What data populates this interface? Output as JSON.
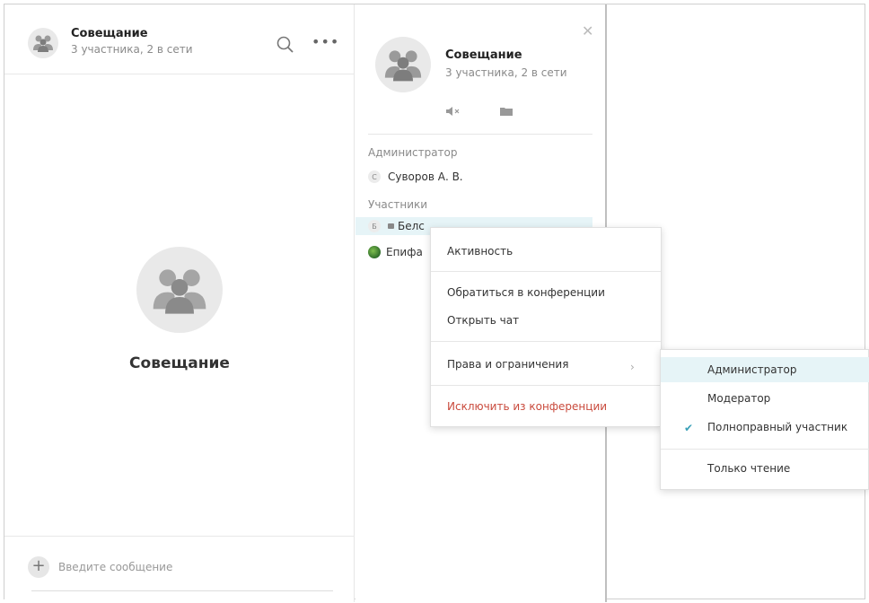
{
  "chat": {
    "title": "Совещание",
    "subtitle": "3 участника, 2 в сети",
    "center_title": "Совещание",
    "composer_placeholder": "Введите сообщение",
    "plus_label": "+"
  },
  "info_panel": {
    "title": "Совещание",
    "subtitle": "3 участника, 2 в сети",
    "admin_section": "Администратор",
    "members_section": "Участники",
    "admins": [
      {
        "initial": "С",
        "name": "Суворов А. В."
      }
    ],
    "members": [
      {
        "initial": "Б",
        "name": "Белс"
      },
      {
        "initial": "",
        "name": "Епифа"
      }
    ]
  },
  "context_menu": {
    "items": [
      "Активность",
      "Обратиться в конференции",
      "Открыть чат",
      "Права и ограничения",
      "Исключить из конференции"
    ]
  },
  "rights_submenu": {
    "items": [
      "Администратор",
      "Модератор",
      "Полноправный участник",
      "Только чтение"
    ],
    "selected": "Полноправный участник",
    "highlighted": "Администратор"
  },
  "colors": {
    "accent": "#3aa0b8",
    "danger": "#c94a3c",
    "highlight": "#e6f4f7"
  }
}
